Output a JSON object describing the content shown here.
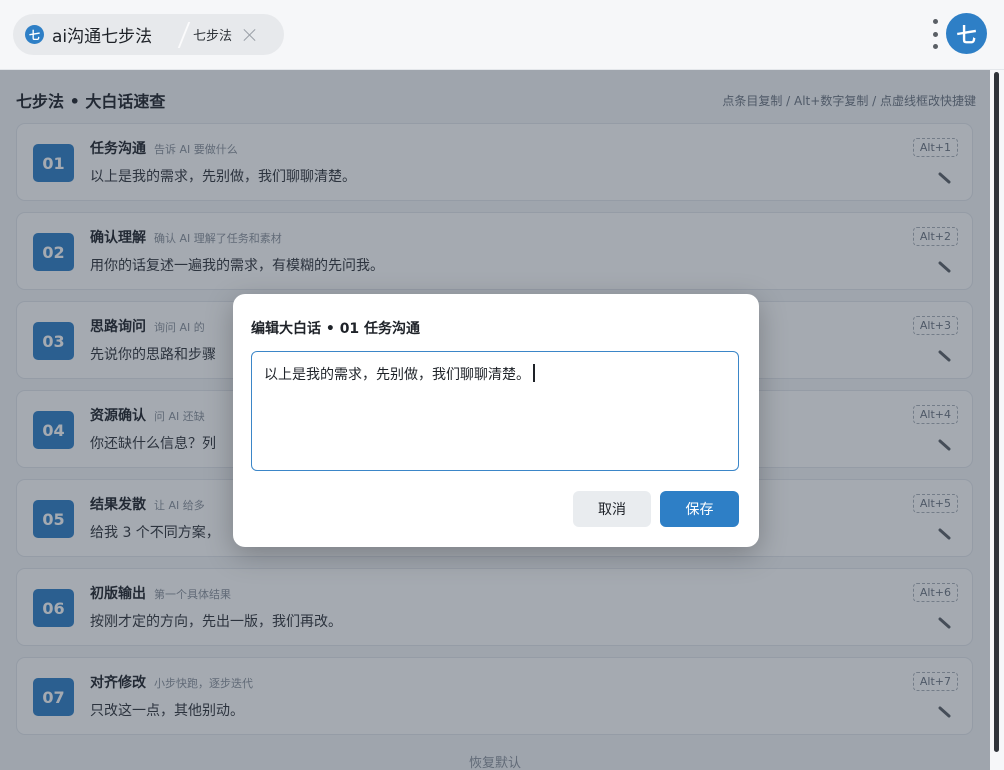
{
  "topbar": {
    "app_logo_text": "七",
    "tab_main_label": "ai沟通七步法",
    "tab_sub_label": "七步法",
    "avatar_text": "七",
    "icons": [
      "app-logo-icon",
      "close-icon",
      "more-vertical-icon",
      "avatar"
    ]
  },
  "main": {
    "title": "七步法 • 大白话速查",
    "hint": "点条目复制 / Alt+数字复制 / 点虚线框改快捷键",
    "steps": [
      {
        "num": "01",
        "title": "任务沟通",
        "subtitle": "告诉 AI 要做什么",
        "text": "以上是我的需求，先别做，我们聊聊清楚。",
        "shortcut": "Alt+1"
      },
      {
        "num": "02",
        "title": "确认理解",
        "subtitle": "确认 AI 理解了任务和素材",
        "text": "用你的话复述一遍我的需求，有模糊的先问我。",
        "shortcut": "Alt+2"
      },
      {
        "num": "03",
        "title": "思路询问",
        "subtitle": "询问 AI 的",
        "text": "先说你的思路和步骤",
        "shortcut": "Alt+3"
      },
      {
        "num": "04",
        "title": "资源确认",
        "subtitle": "问 AI 还缺",
        "text": "你还缺什么信息？列",
        "shortcut": "Alt+4"
      },
      {
        "num": "05",
        "title": "结果发散",
        "subtitle": "让 AI 给多",
        "text": "给我 3 个不同方案，",
        "shortcut": "Alt+5"
      },
      {
        "num": "06",
        "title": "初版输出",
        "subtitle": "第一个具体结果",
        "text": "按刚才定的方向，先出一版，我们再改。",
        "shortcut": "Alt+6"
      },
      {
        "num": "07",
        "title": "对齐修改",
        "subtitle": "小步快跑，逐步迭代",
        "text": "只改这一点，其他别动。",
        "shortcut": "Alt+7"
      }
    ],
    "restore_label": "恢复默认"
  },
  "dialog": {
    "title": "编辑大白话 • 01 任务沟通",
    "textarea_value": "以上是我的需求，先别做，我们聊聊清楚。",
    "cancel_label": "取消",
    "save_label": "保存"
  },
  "colors": {
    "accent": "#2e7fc6",
    "overlay": "rgba(40,52,70,0.42)"
  }
}
